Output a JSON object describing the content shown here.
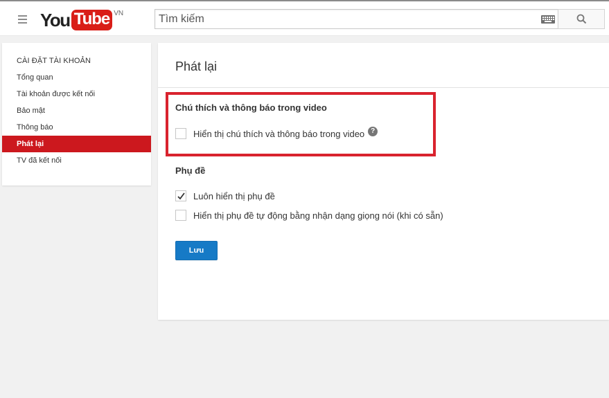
{
  "header": {
    "logo_you": "You",
    "logo_tube": "Tube",
    "logo_country": "VN",
    "search_placeholder": "Tìm kiếm"
  },
  "sidebar": {
    "heading": "CÀI ĐẶT TÀI KHOẢN",
    "items": [
      {
        "label": "Tổng quan",
        "active": false
      },
      {
        "label": "Tài khoản được kết nối",
        "active": false
      },
      {
        "label": "Bảo mật",
        "active": false
      },
      {
        "label": "Thông báo",
        "active": false
      },
      {
        "label": "Phát lại",
        "active": true
      },
      {
        "label": "TV đã kết nối",
        "active": false
      }
    ]
  },
  "main": {
    "title": "Phát lại",
    "annotations": {
      "title": "Chú thích và thông báo trong video",
      "option_label": "Hiển thị chú thích và thông báo trong video",
      "option_checked": false,
      "help_glyph": "?"
    },
    "subtitles": {
      "title": "Phụ đề",
      "options": [
        {
          "label": "Luôn hiển thị phụ đề",
          "checked": true
        },
        {
          "label": "Hiển thị phụ đề tự động bằng nhận dạng giọng nói (khi có sẵn)",
          "checked": false
        }
      ]
    },
    "save_label": "Lưu"
  },
  "colors": {
    "accent_red": "#cc181e",
    "highlight_border": "#d9232e",
    "button_blue": "#167ac6"
  },
  "icons": {
    "menu": "hamburger-menu-icon",
    "keyboard": "keyboard-icon",
    "search": "search-icon",
    "help": "help-icon",
    "check": "checkmark-icon"
  }
}
